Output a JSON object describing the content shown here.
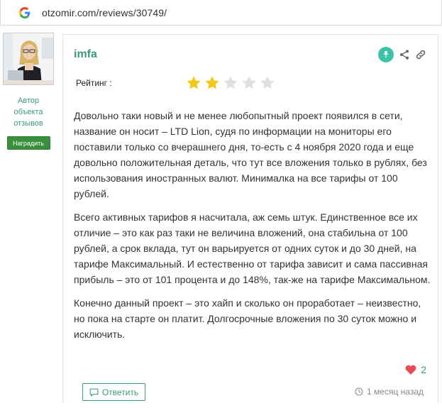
{
  "browser": {
    "url": "otzomir.com/reviews/30749/",
    "search_icon": "google-g-icon"
  },
  "author": {
    "label_line1": "Автор",
    "label_line2": "объекта",
    "label_line3": "отзывов",
    "reward_label": "Наградить"
  },
  "review": {
    "username": "imfa",
    "rating_label": "Рейтинг :",
    "rating": 2,
    "rating_max": 5,
    "paragraphs": [
      "Довольно таки новый и не менее любопытный проект появился в сети, название он носит – LTD Lion, судя по информации на мониторы его поставили только со вчерашнего дня, то-есть с 4 ноября 2020 года и еще довольно положительная деталь, что тут все вложения только в рублях, без использования иностранных валют. Минималка на все тарифы от 100 рублей.",
      "Всего активных тарифов я насчитала, аж семь штук. Единственное все их отличие – это как раз таки не величина вложений, она стабильна от 100 рублей, а срок вклада, тут он варьируется от одних суток и до 30 дней, на тарифе Максимальный. И естественно от тарифа зависит и сама пассивная прибыль – это от 101 процента и до 148%, так-же на тарифе Максимальном.",
      "Конечно данный проект – это хайп и сколько он проработает – неизвестно, но пока на старте он платит. Долгосрочные вложения по 30 суток можно и исключить."
    ],
    "likes": "2",
    "reply_label": "Ответить",
    "time_ago": "1 месяц назад"
  },
  "colors": {
    "accent": "#3a9a76",
    "star_on": "#f5c518",
    "star_off": "#e0e0e0",
    "pin": "#3cc3a3",
    "heart": "#e94b5a",
    "reward": "#3a8f3e"
  }
}
